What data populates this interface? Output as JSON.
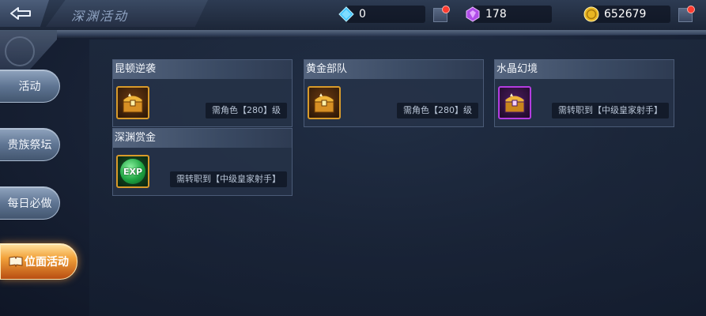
{
  "header": {
    "title": "深渊活动",
    "back_icon": "back-arrow-icon"
  },
  "currencies": [
    {
      "name": "diamond",
      "icon": "blue-diamond-icon",
      "value": "0",
      "color": "#3ec3ff"
    },
    {
      "name": "crystal",
      "icon": "purple-crystal-icon",
      "value": "178",
      "color": "#c05cff"
    },
    {
      "name": "gold",
      "icon": "gold-coin-icon",
      "value": "652679",
      "color": "#f2c230"
    }
  ],
  "sidebar": {
    "items": [
      {
        "label": "活动",
        "active": false
      },
      {
        "label": "贵族祭坛",
        "active": false
      },
      {
        "label": "每日必做",
        "active": false
      },
      {
        "label": "位面活动",
        "active": true,
        "icon": "book-icon"
      }
    ]
  },
  "cards": [
    {
      "title": "昆顿逆袭",
      "reward_icon": "gold-chest-icon",
      "requirement": "需角色【280】级"
    },
    {
      "title": "黄金部队",
      "reward_icon": "gold-chest-icon",
      "requirement": "需角色【280】级"
    },
    {
      "title": "水晶幻境",
      "reward_icon": "purple-chest-icon",
      "requirement": "需转职到【中级皇家射手】"
    },
    {
      "title": "深渊赏金",
      "reward_icon": "exp-orb-icon",
      "reward_text": "EXP",
      "requirement": "需转职到【中级皇家射手】"
    }
  ]
}
